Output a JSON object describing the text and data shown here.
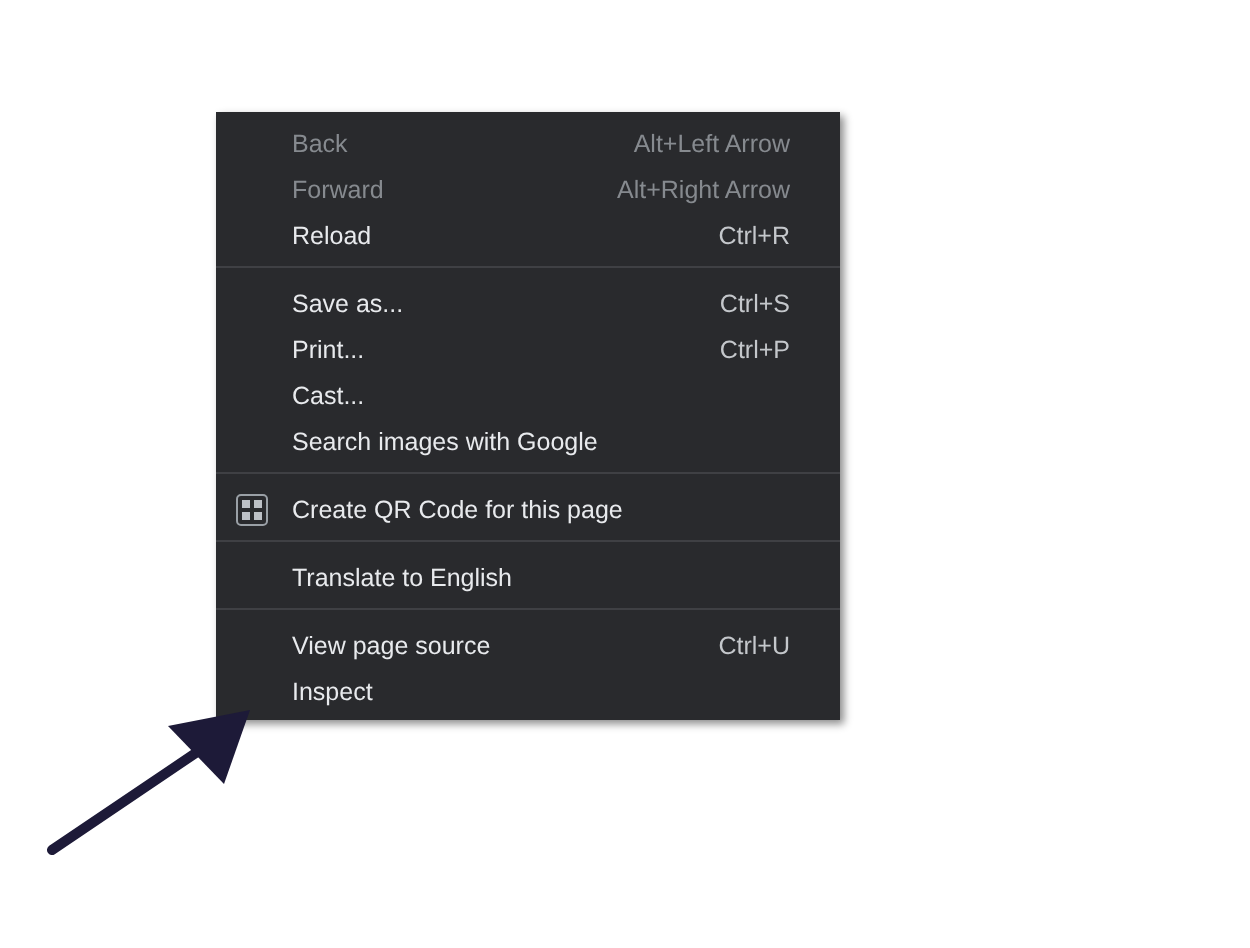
{
  "context_menu": {
    "groups": [
      {
        "items": [
          {
            "kind": "item",
            "label": "Back",
            "shortcut": "Alt+Left Arrow",
            "disabled": true
          },
          {
            "kind": "item",
            "label": "Forward",
            "shortcut": "Alt+Right Arrow",
            "disabled": true
          },
          {
            "kind": "item",
            "label": "Reload",
            "shortcut": "Ctrl+R",
            "disabled": false
          }
        ]
      },
      {
        "items": [
          {
            "kind": "item",
            "label": "Save as...",
            "shortcut": "Ctrl+S",
            "disabled": false
          },
          {
            "kind": "item",
            "label": "Print...",
            "shortcut": "Ctrl+P",
            "disabled": false
          },
          {
            "kind": "item",
            "label": "Cast...",
            "disabled": false
          },
          {
            "kind": "item",
            "label": "Search images with Google",
            "disabled": false
          }
        ]
      },
      {
        "items": [
          {
            "kind": "qr_item",
            "label": "Create QR Code for this page",
            "disabled": false
          }
        ]
      },
      {
        "items": [
          {
            "kind": "item",
            "label": "Translate to English",
            "disabled": false
          }
        ]
      },
      {
        "items": [
          {
            "kind": "item",
            "label": "View page source",
            "shortcut": "Ctrl+U",
            "disabled": false
          },
          {
            "kind": "item",
            "label": "Inspect",
            "disabled": false
          }
        ]
      }
    ]
  }
}
